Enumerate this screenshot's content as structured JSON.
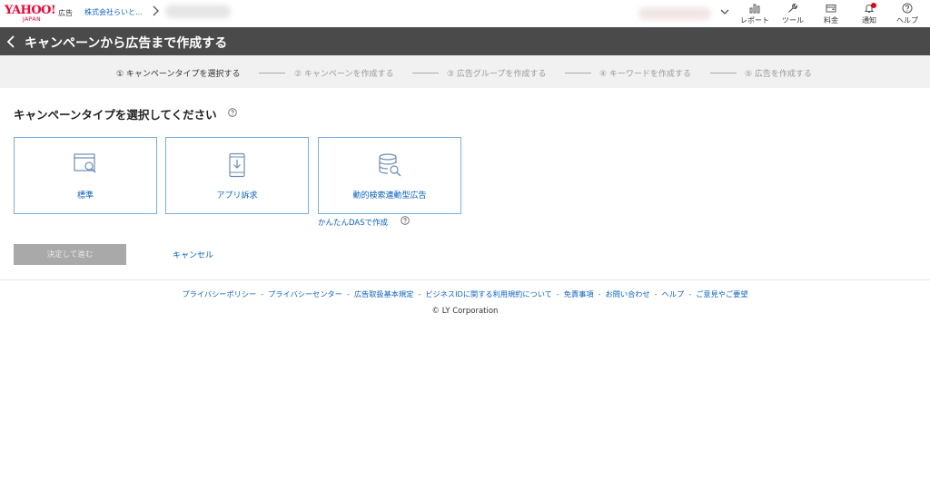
{
  "brand": {
    "logo_main": "YAHOO!",
    "logo_sub": "JAPAN",
    "service": "広告",
    "account": "株式会社らいと…"
  },
  "nav": [
    {
      "label": "レポート",
      "icon": "bar-chart-icon"
    },
    {
      "label": "ツール",
      "icon": "wrench-icon"
    },
    {
      "label": "料金",
      "icon": "wallet-icon"
    },
    {
      "label": "通知",
      "icon": "bell-icon"
    },
    {
      "label": "ヘルプ",
      "icon": "help-circle-icon"
    }
  ],
  "title": "キャンペーンから広告まで作成する",
  "steps": [
    {
      "label": "① キャンペーンタイプを選択する",
      "active": true
    },
    {
      "label": "② キャンペーンを作成する",
      "active": false
    },
    {
      "label": "③ 広告グループを作成する",
      "active": false
    },
    {
      "label": "④ キーワードを作成する",
      "active": false
    },
    {
      "label": "⑤ 広告を作成する",
      "active": false
    }
  ],
  "main": {
    "heading": "キャンペーンタイプを選択してください",
    "cards": [
      {
        "label": "標準",
        "icon": "browser-search-icon"
      },
      {
        "label": "アプリ訴求",
        "icon": "smartphone-download-icon"
      },
      {
        "label": "動的検索連動型広告",
        "icon": "database-search-icon"
      }
    ],
    "das_link": "かんたんDASで作成",
    "submit": "決定して進む",
    "cancel": "キャンセル"
  },
  "footer": {
    "links": [
      "プライバシーポリシー",
      "プライバシーセンター",
      "広告取扱基本規定",
      "ビジネスIDに関する利用規約について",
      "免責事項",
      "お問い合わせ",
      "ヘルプ",
      "ご意見やご要望"
    ],
    "separator": "-",
    "copyright": "© LY Corporation"
  },
  "colors": {
    "accent": "#0b63c6",
    "titlebar": "#4a4a4a",
    "brand": "#ff0033",
    "card_border": "#7aaedc"
  }
}
